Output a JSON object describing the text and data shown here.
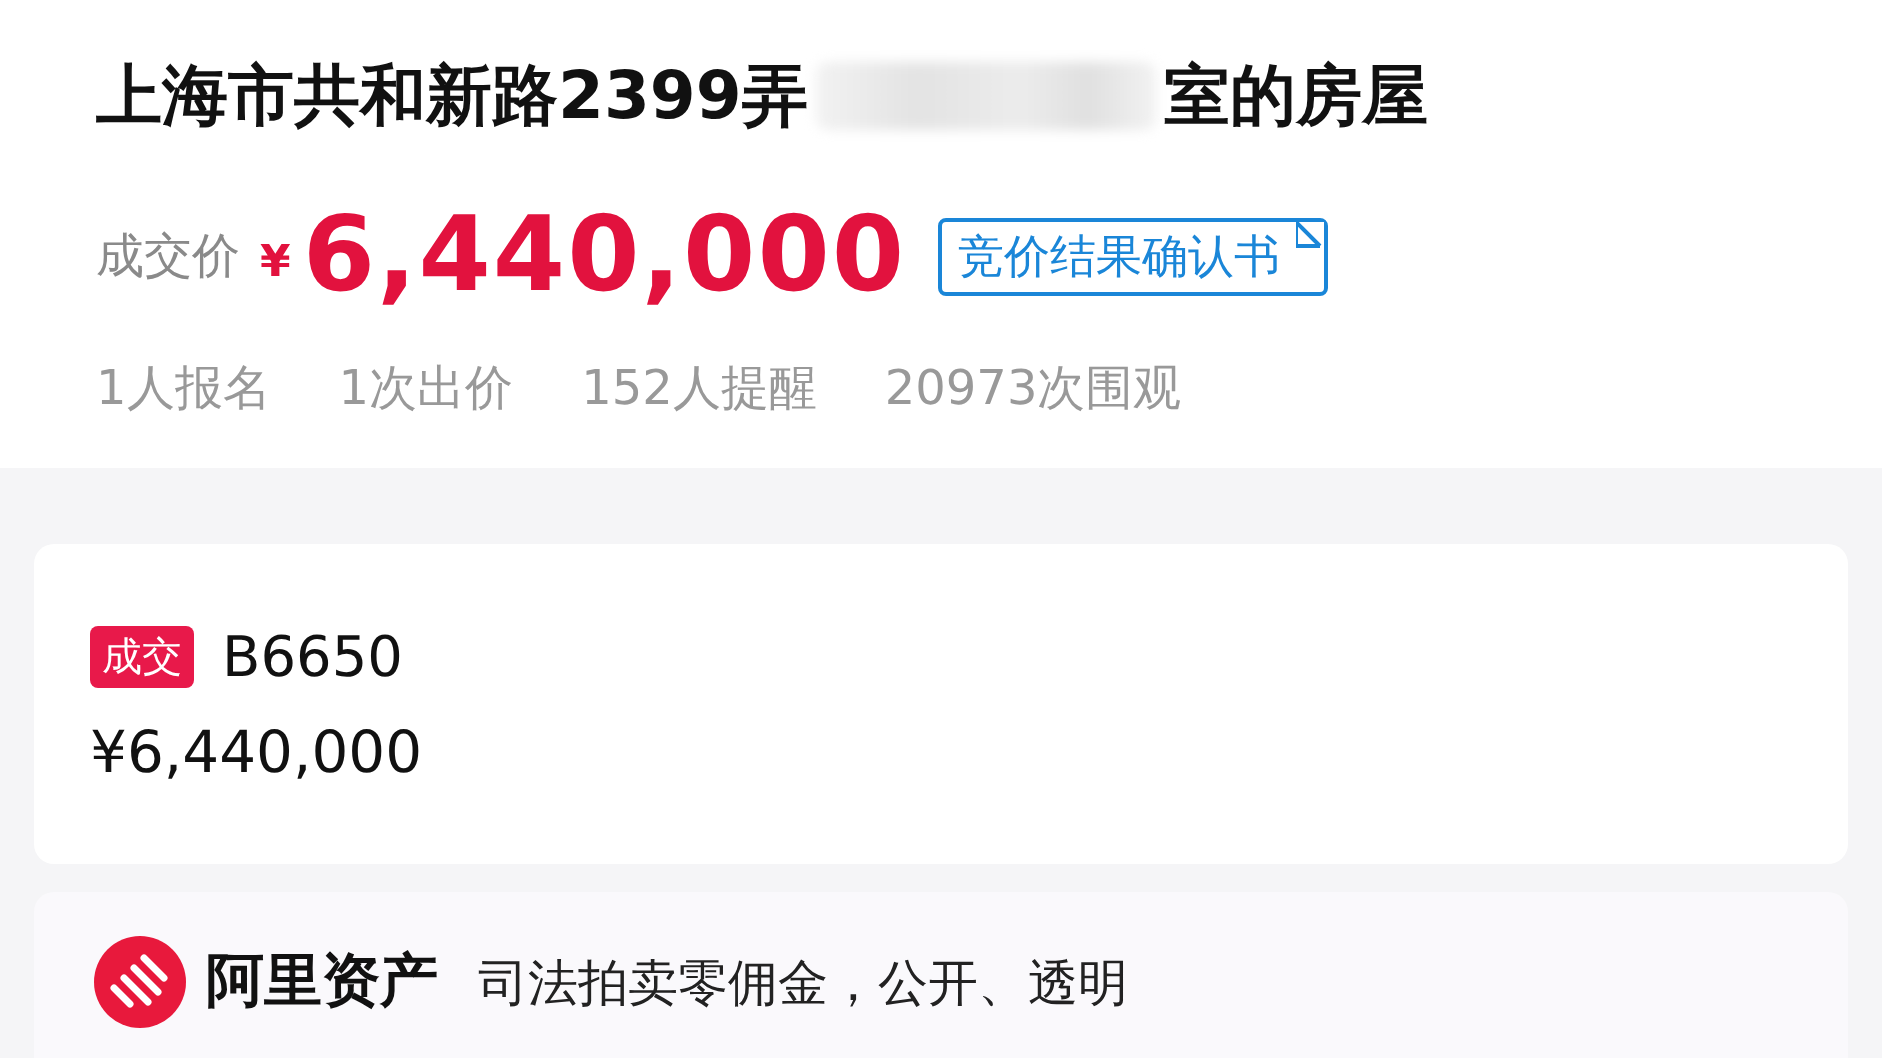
{
  "title": {
    "before": "上海市共和新路2399弄",
    "redacted": true,
    "after": "室的房屋"
  },
  "price": {
    "label": "成交价",
    "currency": "¥",
    "amount": "6,440,000",
    "document_link": "竞价结果确认书"
  },
  "stats": [
    "1人报名",
    "1次出价",
    "152人提醒",
    "20973次围观"
  ],
  "result": {
    "status": "成交",
    "bidder": "B6650",
    "amount": "¥6,440,000"
  },
  "footer": {
    "brand": "阿里资产",
    "slogan": "司法拍卖零佣金，公开、透明"
  }
}
